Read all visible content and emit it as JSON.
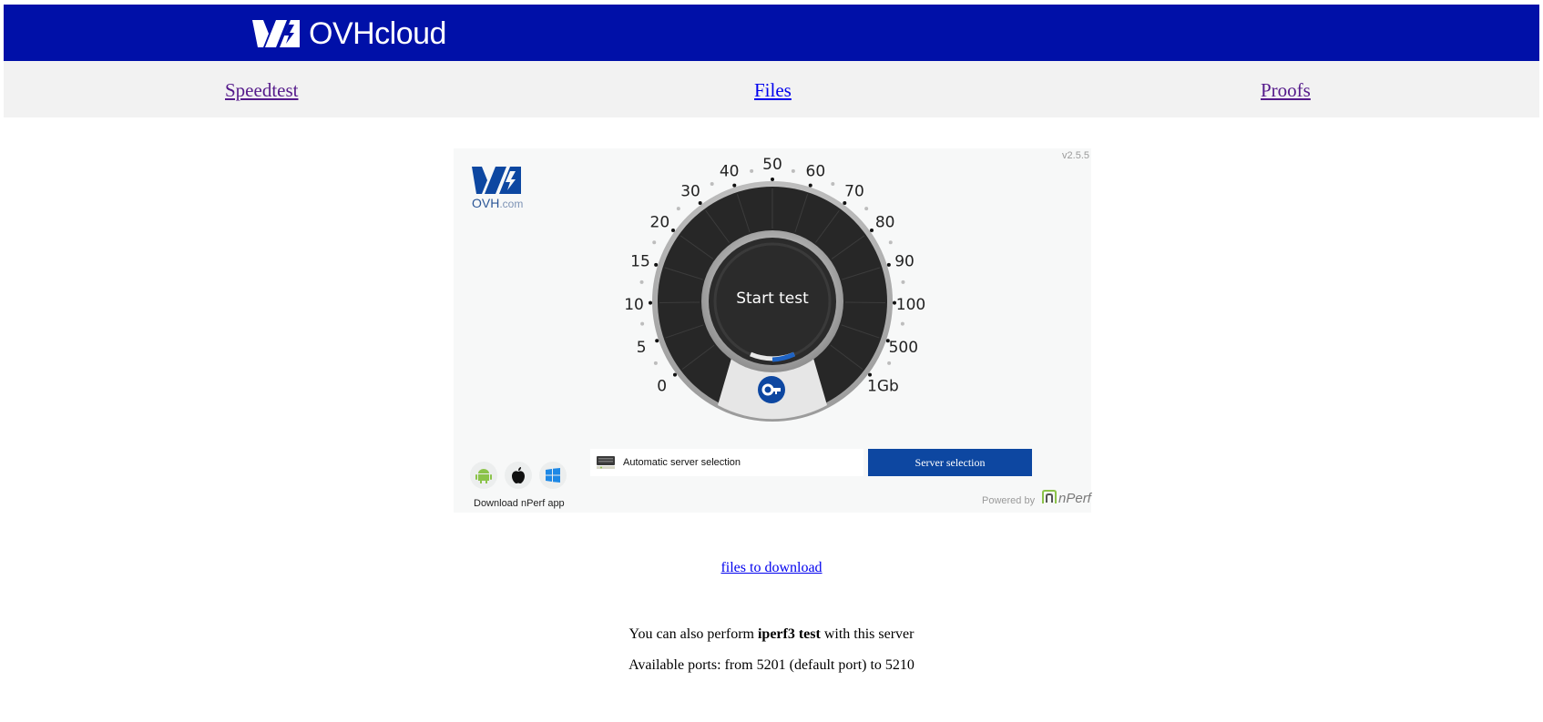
{
  "header": {
    "brand": "OVHcloud",
    "background": "#0010a8"
  },
  "nav": {
    "speedtest": "Speedtest",
    "files": "Files",
    "proofs": "Proofs"
  },
  "widget": {
    "version": "v2.5.5",
    "logo_main": "OVH",
    "logo_suffix": ".com",
    "start_label": "Start test",
    "gauge_labels": [
      "0",
      "5",
      "10",
      "15",
      "20",
      "30",
      "40",
      "50",
      "60",
      "70",
      "80",
      "90",
      "100",
      "500",
      "1Gb"
    ],
    "download_label": "Download nPerf app",
    "app_icons": [
      "android-icon",
      "apple-icon",
      "windows-icon"
    ],
    "server_text": "Automatic server selection",
    "server_button": "Server selection",
    "powered_by": "Powered by",
    "nperf_brand": "nPerf",
    "accent": "#0d47a1"
  },
  "files_link": "files to download",
  "info": {
    "line1_prefix": "You can also perform ",
    "line1_bold": "iperf3 test",
    "line1_suffix": " with this server",
    "line2": "Available ports: from 5201 (default port) to 5210"
  }
}
